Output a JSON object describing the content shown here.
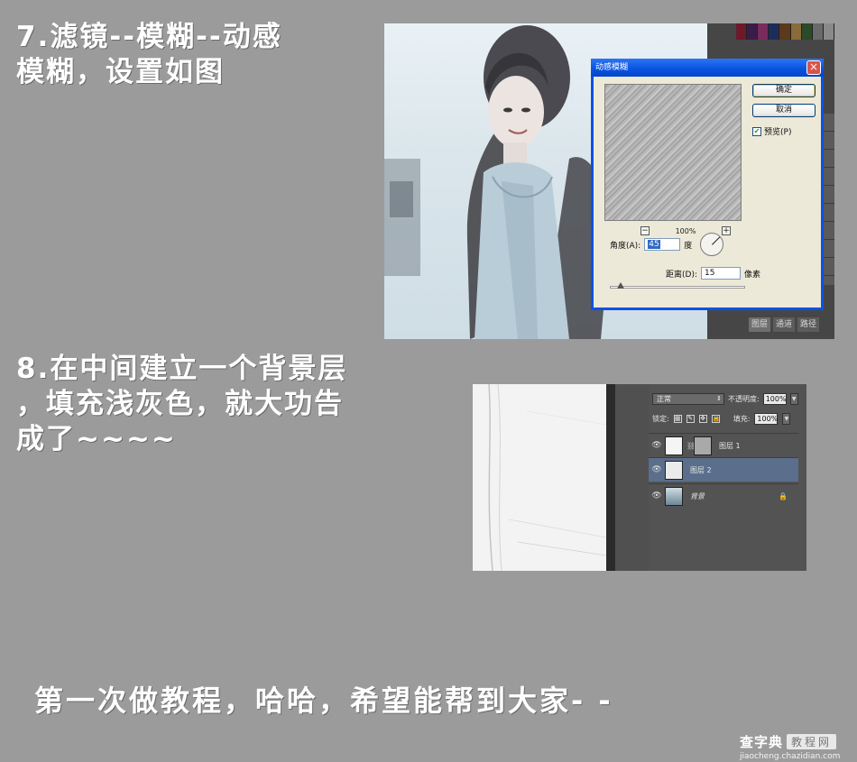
{
  "step7": {
    "line1": "7.滤镜--模糊--动感",
    "line2": "模糊，设置如图"
  },
  "dialog": {
    "title": "动感模糊",
    "ok_label": "确定",
    "cancel_label": "取消",
    "preview_label": "预览(P)",
    "preview_checked": true,
    "zoom_value": "100%",
    "angle_label": "角度(A):",
    "angle_value": "45",
    "angle_unit": "度",
    "distance_label": "距离(D):",
    "distance_value": "15",
    "distance_unit": "像素"
  },
  "ps_panel_tabs": [
    "图层",
    "通道",
    "路径"
  ],
  "step8": {
    "line1": "8.在中间建立一个背景层",
    "line2": "，填充浅灰色，就大功告",
    "line3": "成了~~~~"
  },
  "layers_panel": {
    "blend_mode": "正常",
    "opacity_label": "不透明度:",
    "opacity_value": "100%",
    "lock_label": "锁定:",
    "fill_label": "填充:",
    "fill_value": "100%",
    "layers": [
      {
        "name": "图层 1"
      },
      {
        "name": "图层 2",
        "selected": true
      },
      {
        "name": "背景",
        "locked": true
      }
    ]
  },
  "closing": "第一次做教程，哈哈，希望能帮到大家- -",
  "watermark": {
    "brand": "查字典",
    "box": "教程网",
    "url": "jiaocheng.chazidian.com"
  },
  "colors": {
    "background": "#9b9b9b",
    "caption": "#ffffff",
    "dialog_title": "#0a54e2",
    "selected_layer": "#5b6f8c"
  }
}
